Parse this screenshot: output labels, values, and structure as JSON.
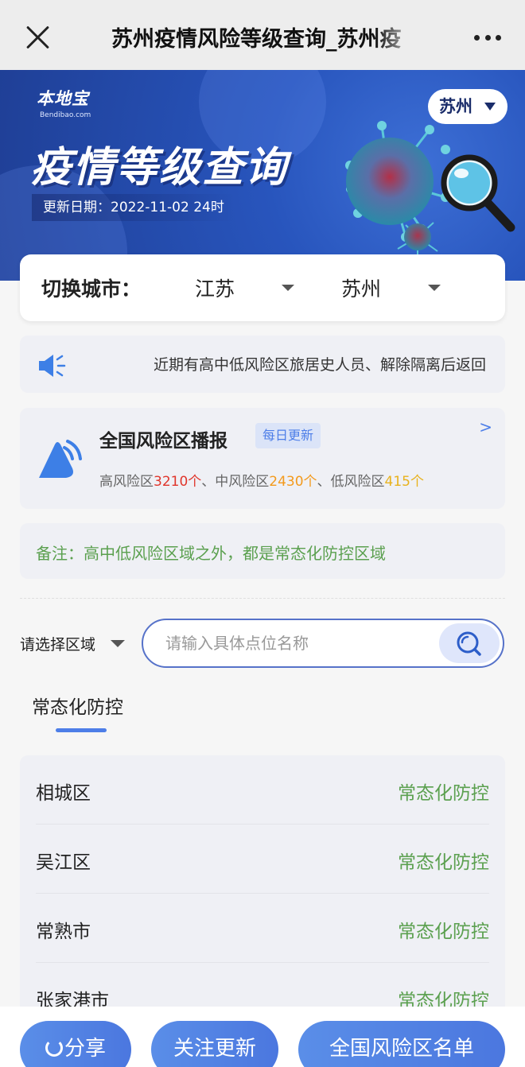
{
  "topbar": {
    "title": "苏州疫情风险等级查询_苏州疫"
  },
  "banner": {
    "logo_text": "本地宝",
    "logo_sub": "Bendibao.com",
    "title": "疫情等级查询",
    "update_date": "更新日期：2022-11-02 24时",
    "city_pill": "苏州"
  },
  "selector": {
    "label": "切换城市：",
    "province": "江苏",
    "city": "苏州"
  },
  "notice": {
    "text": "近期有高中低风险区旅居史人员、解除隔离后返回"
  },
  "national": {
    "title": "全国风险区播报",
    "badge": "每日更新",
    "arrow": ">",
    "high_label": "高风险区",
    "high_count": "3210个",
    "sep1": "、中风险区",
    "mid_count": "2430个",
    "sep2": "、低风险区",
    "low_count": "415个"
  },
  "remark": {
    "text": "备注：高中低风险区域之外，都是常态化防控区域"
  },
  "search": {
    "area_select": "请选择区域",
    "placeholder": "请输入具体点位名称"
  },
  "tabs": {
    "active": "常态化防控"
  },
  "districts": [
    {
      "name": "相城区",
      "status": "常态化防控"
    },
    {
      "name": "吴江区",
      "status": "常态化防控"
    },
    {
      "name": "常熟市",
      "status": "常态化防控"
    },
    {
      "name": "张家港市",
      "status": "常态化防控"
    }
  ],
  "bottom": {
    "share": "分享",
    "follow": "关注更新",
    "national_list": "全国风险区名单"
  },
  "colors": {
    "primary_blue": "#4d7ee8",
    "high_risk": "#e0352b",
    "mid_risk": "#f39a1c",
    "low_risk": "#e8b21d",
    "normal_green": "#5ba04f"
  },
  "icons": [
    "close-icon",
    "more-icon",
    "dropdown-icon",
    "speaker-icon",
    "bell-icon",
    "search-icon",
    "share-icon"
  ]
}
